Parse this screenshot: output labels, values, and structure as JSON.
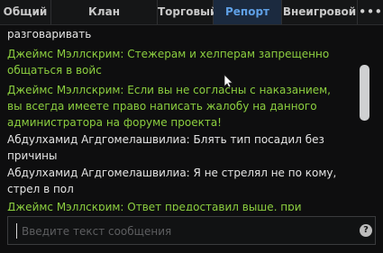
{
  "tabs": [
    {
      "label": "Общий",
      "active": false
    },
    {
      "label": "Клан",
      "active": false
    },
    {
      "label": "Торговый",
      "active": false
    },
    {
      "label": "Репорт",
      "active": true
    },
    {
      "label": "Внеигровой",
      "active": false
    }
  ],
  "more_label": "•••",
  "messages": [
    {
      "text": "разговаривать",
      "type": "player"
    },
    {
      "text": "Джеймс Мэллскрим: Стежерам и хелперам запрещенно\nобщаться в войс",
      "type": "admin"
    },
    {
      "text": "Джеймс Мэллскрим: Если вы не согласны с наказанием,\nвы всегда имеете право написать жалобу на данного\nадминистратора на форуме проекта!",
      "type": "admin"
    },
    {
      "text": "Абдулхамид Агдгомелашвилиа: Блять тип посадил без\nпричины",
      "type": "player"
    },
    {
      "text": "Абдулхамид Агдгомелашвилиа: Я не стрелял не по кому,\nстрел в пол",
      "type": "player"
    },
    {
      "text": "Джеймс Мэллскрим: Ответ предоставил выше, при",
      "type": "admin"
    }
  ],
  "input": {
    "placeholder": "Введите текст сообщения",
    "value": ""
  },
  "help_label": "?",
  "colors": {
    "admin": "#8ccf3f",
    "player": "#e4e4e4",
    "active_tab": "#5fa0e6"
  }
}
